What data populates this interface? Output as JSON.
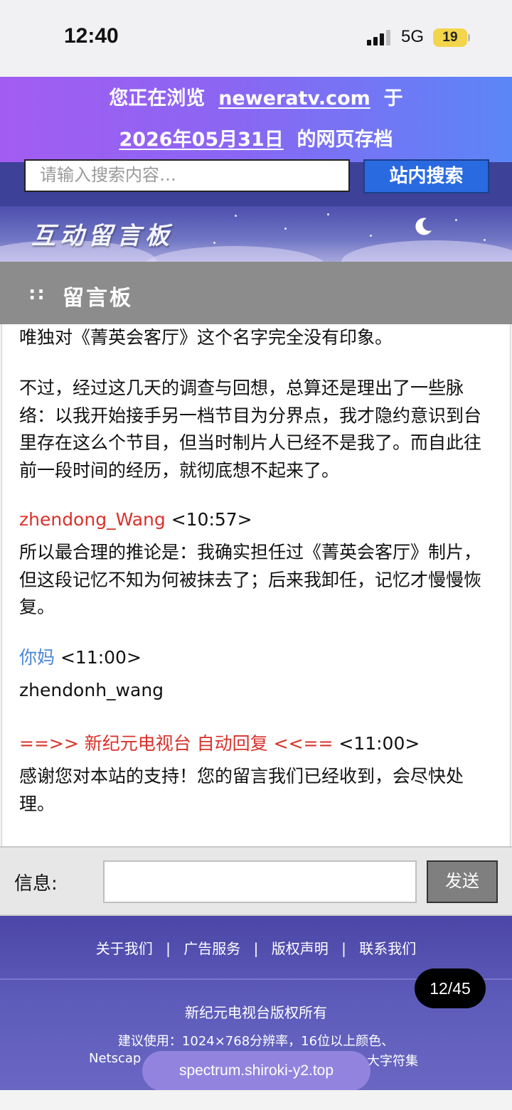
{
  "status_bar": {
    "time": "12:40",
    "network": "5G",
    "battery": "19"
  },
  "archive_banner": {
    "prefix": "您正在浏览",
    "site": "neweratv.com",
    "middle": "于",
    "date": "2026年05月31日",
    "suffix": "的网页存档"
  },
  "search": {
    "placeholder": "请输入搜索内容…",
    "button_label": "站内搜索"
  },
  "board_banner": {
    "title": "互动留言板"
  },
  "section": {
    "dots": "::",
    "title": "留言板"
  },
  "messages": [
    {
      "text": "唯独对《菁英会客厅》这个名字完全没有印象。"
    },
    {
      "text": "不过，经过这几天的调查与回想，总算还是理出了一些脉络：以我开始接手另一档节目为分界点，我才隐约意识到台里存在这么个节目，但当时制片人已经不是我了。而自此往前一段时间的经历，就彻底想不起来了。"
    },
    {
      "author": "zhendong_Wang",
      "time": "<10:57>",
      "author_color": "#d8322b",
      "text": "所以最合理的推论是：我确实担任过《菁英会客厅》制片，但这段记忆不知为何被抹去了；后来我卸任，记忆才慢慢恢复。"
    },
    {
      "author": "你妈",
      "time": "<11:00>",
      "author_color": "#4a86d8",
      "text": "zhendonh_wang"
    },
    {
      "author": "==>> 新纪元电视台 自动回复 <<==",
      "time": "<11:00>",
      "author_color": "#d8322b",
      "text": "感谢您对本站的支持！您的留言我们已经收到，会尽快处理。"
    }
  ],
  "input_bar": {
    "label": "信息:",
    "value": "",
    "send_label": "发送"
  },
  "footer": {
    "links": [
      "关于我们",
      "广告服务",
      "版权声明",
      "联系我们"
    ],
    "separator": "|",
    "copyright": "新纪元电视台版权所有",
    "suggest_line1": "建议使用：1024×768分辨率，16位以上颜色、",
    "suggest_line2_start": "Netscap",
    "suggest_line2_end": "大字符集"
  },
  "overlays": {
    "page_indicator": "12/45",
    "domain_pill": "spectrum.shiroki-y2.top"
  },
  "colors": {
    "banner_start": "#a35cf2",
    "banner_end": "#5b86f6",
    "header_bg": "#3d4198",
    "red_name": "#d8322b",
    "blue_name": "#4a86d8"
  }
}
